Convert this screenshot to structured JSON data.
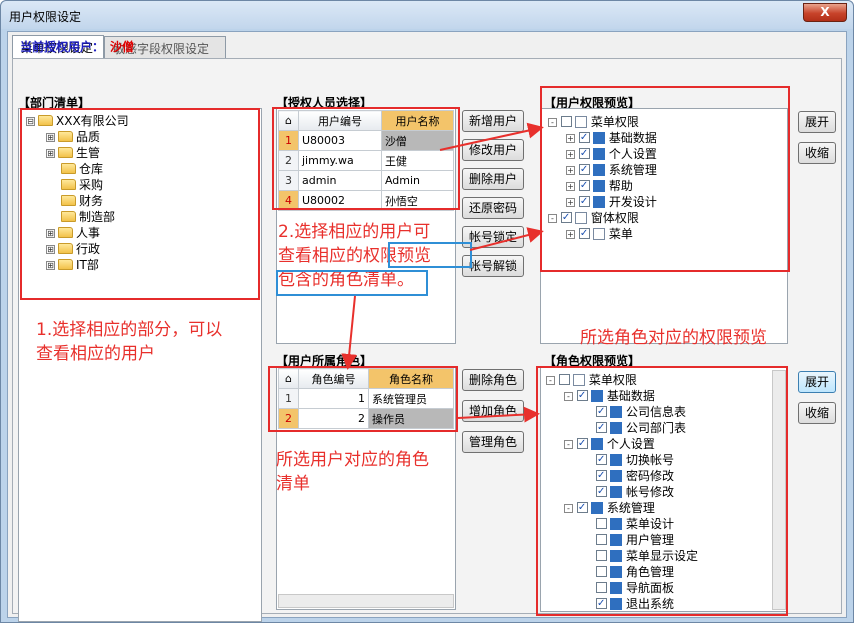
{
  "window": {
    "title": "用户权限设定",
    "close": "X"
  },
  "tabs": [
    "菜单权限设定",
    "敏感字段权限设定"
  ],
  "current_user": {
    "label": "当前授权用户：",
    "value": "沙僧"
  },
  "dept": {
    "title": "【部门清单】",
    "items": [
      {
        "label": "XXX有限公司",
        "expander": "⊟"
      },
      {
        "label": "品质",
        "expander": "⊞"
      },
      {
        "label": "生管",
        "expander": "⊞"
      },
      {
        "label": "仓库",
        "expander": ""
      },
      {
        "label": "采购",
        "expander": ""
      },
      {
        "label": "财务",
        "expander": ""
      },
      {
        "label": "制造部",
        "expander": ""
      },
      {
        "label": "人事",
        "expander": "⊞"
      },
      {
        "label": "行政",
        "expander": "⊞"
      },
      {
        "label": "IT部",
        "expander": "⊞"
      }
    ]
  },
  "auth_users": {
    "title": "【授权人员选择】",
    "corner": "⌂",
    "columns": [
      "用户编号",
      "用户名称"
    ],
    "rows": [
      {
        "idx": "1",
        "code": "U80003",
        "name": "沙僧"
      },
      {
        "idx": "2",
        "code": "jimmy.wa",
        "name": "王健"
      },
      {
        "idx": "3",
        "code": "admin",
        "name": "Admin"
      },
      {
        "idx": "4",
        "code": "U80002",
        "name": "孙悟空"
      }
    ]
  },
  "user_buttons": [
    "新增用户",
    "修改用户",
    "删除用户",
    "还原密码",
    "帐号锁定",
    "帐号解锁"
  ],
  "user_perm": {
    "title": "【用户权限预览】",
    "items": [
      {
        "label": "菜单权限",
        "icon": "doc"
      },
      {
        "label": "基础数据",
        "icon": "blue"
      },
      {
        "label": "个人设置",
        "icon": "blue"
      },
      {
        "label": "系统管理",
        "icon": "blue"
      },
      {
        "label": "帮助",
        "icon": "blue"
      },
      {
        "label": "开发设计",
        "icon": "blue"
      },
      {
        "label": "窗体权限",
        "icon": "doc"
      },
      {
        "label": "菜单",
        "icon": "doc"
      }
    ]
  },
  "expand_label": "展开",
  "collapse_label": "收缩",
  "user_roles": {
    "title": "【用户所属角色】",
    "corner": "⌂",
    "columns": [
      "角色编号",
      "角色名称"
    ],
    "rows": [
      {
        "idx": "1",
        "code": "1",
        "name": "系统管理员"
      },
      {
        "idx": "2",
        "code": "2",
        "name": "操作员"
      }
    ]
  },
  "role_buttons": [
    "删除角色",
    "增加角色",
    "管理角色"
  ],
  "role_perm": {
    "title": "【角色权限预览】",
    "items": [
      {
        "label": "菜单权限",
        "icon": "doc",
        "level": 0
      },
      {
        "label": "基础数据",
        "icon": "blue",
        "level": 1
      },
      {
        "label": "公司信息表",
        "icon": "blue",
        "level": 2
      },
      {
        "label": "公司部门表",
        "icon": "blue",
        "level": 2
      },
      {
        "label": "个人设置",
        "icon": "blue",
        "level": 1
      },
      {
        "label": "切换帐号",
        "icon": "blue",
        "level": 2
      },
      {
        "label": "密码修改",
        "icon": "blue",
        "level": 2
      },
      {
        "label": "帐号修改",
        "icon": "blue",
        "level": 2
      },
      {
        "label": "系统管理",
        "icon": "blue",
        "level": 1
      },
      {
        "label": "菜单设计",
        "icon": "blue",
        "level": 2
      },
      {
        "label": "用户管理",
        "icon": "blue",
        "level": 2
      },
      {
        "label": "菜单显示设定",
        "icon": "blue",
        "level": 2
      },
      {
        "label": "角色管理",
        "icon": "blue",
        "level": 2
      },
      {
        "label": "导航面板",
        "icon": "blue",
        "level": 2
      },
      {
        "label": "退出系统",
        "icon": "blue",
        "level": 2
      }
    ]
  },
  "annotations": {
    "a1_line1": "1.选择相应的部分，可以",
    "a1_line2": "查看相应的用户",
    "a2_line1": "2.选择相应的用户可",
    "a2_line2": "查看相应的权限预览",
    "a2_line3": "包含的角色清单。",
    "a3": "所选角色对应的权限预览",
    "a4_line1": "所选用户对应的角色",
    "a4_line2": "清单"
  },
  "colors": {
    "annot": "#e8302c",
    "blue_box": "#2f8fd6",
    "sel_header": "#f3c46a"
  }
}
